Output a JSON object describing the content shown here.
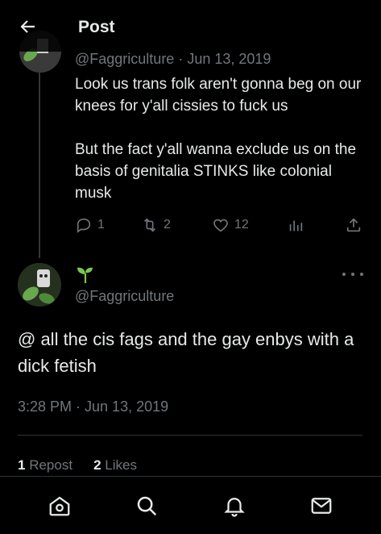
{
  "header": {
    "title": "Post",
    "back_icon": "arrow-left-icon"
  },
  "parent_post": {
    "handle": "@Faggriculture",
    "date": "Jun 13, 2019",
    "text": "Look us trans folk aren't gonna beg on our knees for y'all cissies to fuck us\n\nBut the fact y'all wanna exclude us on the basis of genitalia STINKS like colonial musk",
    "replies": "1",
    "reposts": "2",
    "likes": "12"
  },
  "main_post": {
    "display_name_icon": "seedling-icon",
    "handle": "@Faggriculture",
    "text": "@ all the cis fags and the gay enbys with a dick fetish",
    "timestamp": "3:28 PM · Jun 13, 2019",
    "reposts_count": "1",
    "reposts_label": "Repost",
    "likes_count": "2",
    "likes_label": "Likes"
  },
  "colors": {
    "background": "#000000",
    "text": "#e7e9ea",
    "muted": "#71767b",
    "border": "#2f3336",
    "accent_green": "#7ac74f"
  },
  "bottom_nav": [
    "home-icon",
    "search-icon",
    "notifications-icon",
    "messages-icon"
  ]
}
